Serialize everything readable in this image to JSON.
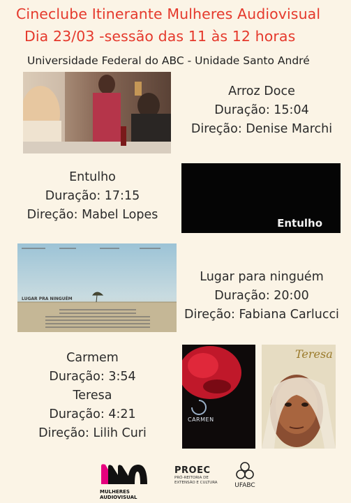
{
  "header": {
    "title": "Cineclube Itinerante Mulheres Audiovisual",
    "session": "Dia 23/03 -sessão das 11 às 12 horas",
    "venue": "Universidade Federal do ABC - Unidade Santo André"
  },
  "films": [
    {
      "title": "Arroz Doce",
      "duration": "Duração: 15:04",
      "director": "Direção: Denise Marchi"
    },
    {
      "title": "Entulho",
      "duration": "Duração: 17:15",
      "director": "Direção: Mabel Lopes",
      "poster_text": "Entulho"
    },
    {
      "title": "Lugar para ninguém",
      "duration": "Duração: 20:00",
      "director": "Direção: Fabiana Carlucci",
      "poster_text": "LUGAR PRA NINGUÉM"
    },
    {
      "title": "Carmem",
      "duration": "Duração: 3:54",
      "poster_text": "CARMEN"
    },
    {
      "title": "Teresa",
      "duration": "Duração: 4:21",
      "director": "Direção: Lilih Curi",
      "poster_text": "Teresa"
    }
  ],
  "footer": {
    "logo1_line1": "MULHERES",
    "logo1_line2": "AUDIOVISUAL",
    "logo2_name": "PROEC",
    "logo2_line1": "PRÓ-REITORIA DE",
    "logo2_line2": "EXTENSÃO E CULTURA",
    "logo3_name": "UFABC"
  }
}
